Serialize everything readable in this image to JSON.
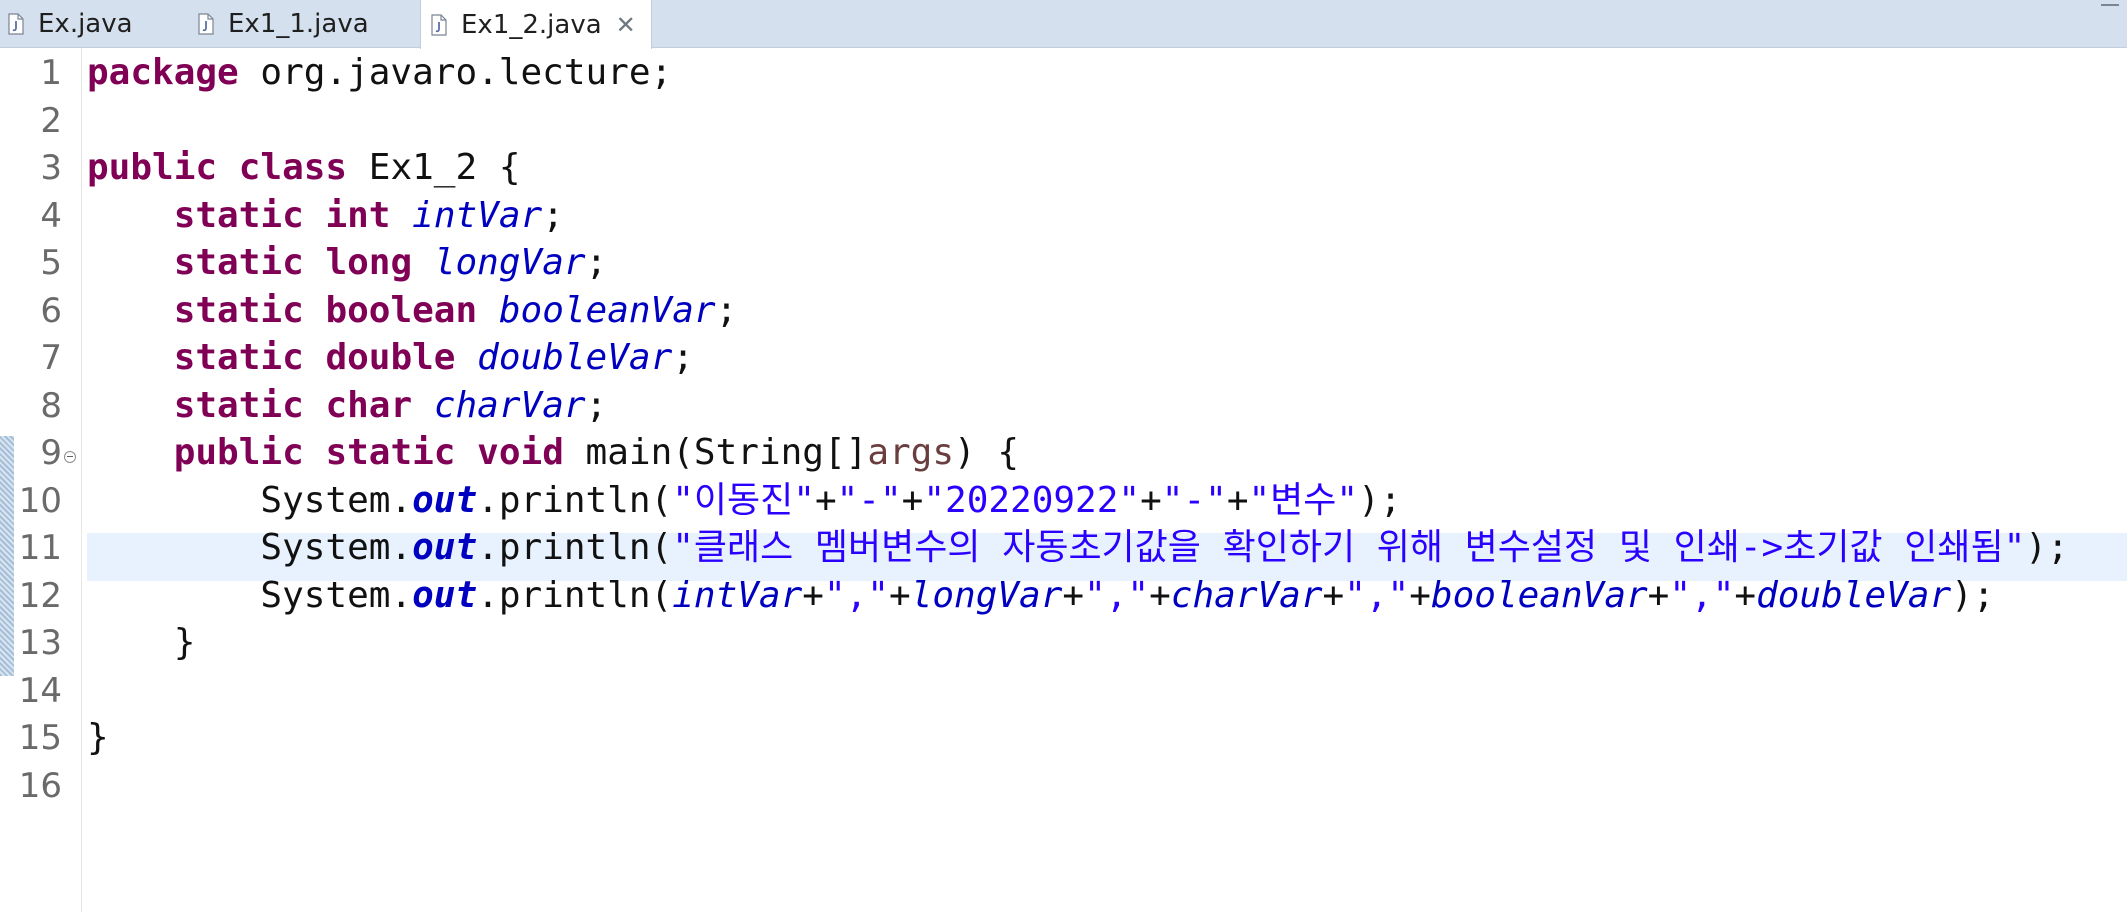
{
  "tabs": [
    {
      "label": "Ex.java",
      "icon": "java-file-icon",
      "active": false
    },
    {
      "label": "Ex1_1.java",
      "icon": "java-file-icon",
      "active": false
    },
    {
      "label": "Ex1_2.java",
      "icon": "java-file-icon",
      "active": true,
      "close": "✕"
    }
  ],
  "colors": {
    "keyword": "#7f0055",
    "field": "#0000c0",
    "string": "#2a00ff",
    "parameter": "#6a3e3e",
    "current_line": "#e8f2fe",
    "tabbar": "#d5e0ee"
  },
  "editor": {
    "line_numbers": [
      "1",
      "2",
      "3",
      "4",
      "5",
      "6",
      "7",
      "8",
      "9",
      "10",
      "11",
      "12",
      "13",
      "14",
      "15",
      "16"
    ],
    "current_line": 11,
    "lines": [
      {
        "tokens": [
          {
            "t": "kw",
            "v": "package"
          },
          {
            "t": "pl",
            "v": " org.javaro.lecture;"
          }
        ]
      },
      {
        "tokens": []
      },
      {
        "tokens": [
          {
            "t": "kw",
            "v": "public"
          },
          {
            "t": "pl",
            "v": " "
          },
          {
            "t": "kw",
            "v": "class"
          },
          {
            "t": "pl",
            "v": " Ex1_2 {"
          }
        ]
      },
      {
        "tokens": [
          {
            "t": "pl",
            "v": "    "
          },
          {
            "t": "kw",
            "v": "static"
          },
          {
            "t": "pl",
            "v": " "
          },
          {
            "t": "kw",
            "v": "int"
          },
          {
            "t": "pl",
            "v": " "
          },
          {
            "t": "fld",
            "v": "intVar"
          },
          {
            "t": "pl",
            "v": ";"
          }
        ]
      },
      {
        "tokens": [
          {
            "t": "pl",
            "v": "    "
          },
          {
            "t": "kw",
            "v": "static"
          },
          {
            "t": "pl",
            "v": " "
          },
          {
            "t": "kw",
            "v": "long"
          },
          {
            "t": "pl",
            "v": " "
          },
          {
            "t": "fld",
            "v": "longVar"
          },
          {
            "t": "pl",
            "v": ";"
          }
        ]
      },
      {
        "tokens": [
          {
            "t": "pl",
            "v": "    "
          },
          {
            "t": "kw",
            "v": "static"
          },
          {
            "t": "pl",
            "v": " "
          },
          {
            "t": "kw",
            "v": "boolean"
          },
          {
            "t": "pl",
            "v": " "
          },
          {
            "t": "fld",
            "v": "booleanVar"
          },
          {
            "t": "pl",
            "v": ";"
          }
        ]
      },
      {
        "tokens": [
          {
            "t": "pl",
            "v": "    "
          },
          {
            "t": "kw",
            "v": "static"
          },
          {
            "t": "pl",
            "v": " "
          },
          {
            "t": "kw",
            "v": "double"
          },
          {
            "t": "pl",
            "v": " "
          },
          {
            "t": "fld",
            "v": "doubleVar"
          },
          {
            "t": "pl",
            "v": ";"
          }
        ]
      },
      {
        "tokens": [
          {
            "t": "pl",
            "v": "    "
          },
          {
            "t": "kw",
            "v": "static"
          },
          {
            "t": "pl",
            "v": " "
          },
          {
            "t": "kw",
            "v": "char"
          },
          {
            "t": "pl",
            "v": " "
          },
          {
            "t": "fld",
            "v": "charVar"
          },
          {
            "t": "pl",
            "v": ";"
          }
        ]
      },
      {
        "tokens": [
          {
            "t": "pl",
            "v": "    "
          },
          {
            "t": "kw",
            "v": "public"
          },
          {
            "t": "pl",
            "v": " "
          },
          {
            "t": "kw",
            "v": "static"
          },
          {
            "t": "pl",
            "v": " "
          },
          {
            "t": "kw",
            "v": "void"
          },
          {
            "t": "pl",
            "v": " main(String[]"
          },
          {
            "t": "param",
            "v": "args"
          },
          {
            "t": "pl",
            "v": ") {"
          }
        ]
      },
      {
        "tokens": [
          {
            "t": "pl",
            "v": "        System."
          },
          {
            "t": "sfld",
            "v": "out"
          },
          {
            "t": "pl",
            "v": ".println("
          },
          {
            "t": "str",
            "v": "\"이동진\""
          },
          {
            "t": "pl",
            "v": "+"
          },
          {
            "t": "str",
            "v": "\"-\""
          },
          {
            "t": "pl",
            "v": "+"
          },
          {
            "t": "str",
            "v": "\"20220922\""
          },
          {
            "t": "pl",
            "v": "+"
          },
          {
            "t": "str",
            "v": "\"-\""
          },
          {
            "t": "pl",
            "v": "+"
          },
          {
            "t": "str",
            "v": "\"변수\""
          },
          {
            "t": "pl",
            "v": ");"
          }
        ]
      },
      {
        "tokens": [
          {
            "t": "pl",
            "v": "        System."
          },
          {
            "t": "sfld",
            "v": "out"
          },
          {
            "t": "pl",
            "v": ".println("
          },
          {
            "t": "str",
            "v": "\"클래스 멤버변수의 자동초기값을 확인하기 위해 변수설정 및 인쇄->초기값 인쇄됨\""
          },
          {
            "t": "pl",
            "v": ");"
          }
        ]
      },
      {
        "tokens": [
          {
            "t": "pl",
            "v": "        System."
          },
          {
            "t": "sfld",
            "v": "out"
          },
          {
            "t": "pl",
            "v": ".println("
          },
          {
            "t": "fld",
            "v": "intVar"
          },
          {
            "t": "pl",
            "v": "+"
          },
          {
            "t": "str",
            "v": "\",\""
          },
          {
            "t": "pl",
            "v": "+"
          },
          {
            "t": "fld",
            "v": "longVar"
          },
          {
            "t": "pl",
            "v": "+"
          },
          {
            "t": "str",
            "v": "\",\""
          },
          {
            "t": "pl",
            "v": "+"
          },
          {
            "t": "fld",
            "v": "charVar"
          },
          {
            "t": "pl",
            "v": "+"
          },
          {
            "t": "str",
            "v": "\",\""
          },
          {
            "t": "pl",
            "v": "+"
          },
          {
            "t": "fld",
            "v": "booleanVar"
          },
          {
            "t": "pl",
            "v": "+"
          },
          {
            "t": "str",
            "v": "\",\""
          },
          {
            "t": "pl",
            "v": "+"
          },
          {
            "t": "fld",
            "v": "doubleVar"
          },
          {
            "t": "pl",
            "v": ");"
          }
        ]
      },
      {
        "tokens": [
          {
            "t": "pl",
            "v": "    }"
          }
        ]
      },
      {
        "tokens": []
      },
      {
        "tokens": [
          {
            "t": "pl",
            "v": "}"
          }
        ]
      },
      {
        "tokens": []
      }
    ]
  }
}
